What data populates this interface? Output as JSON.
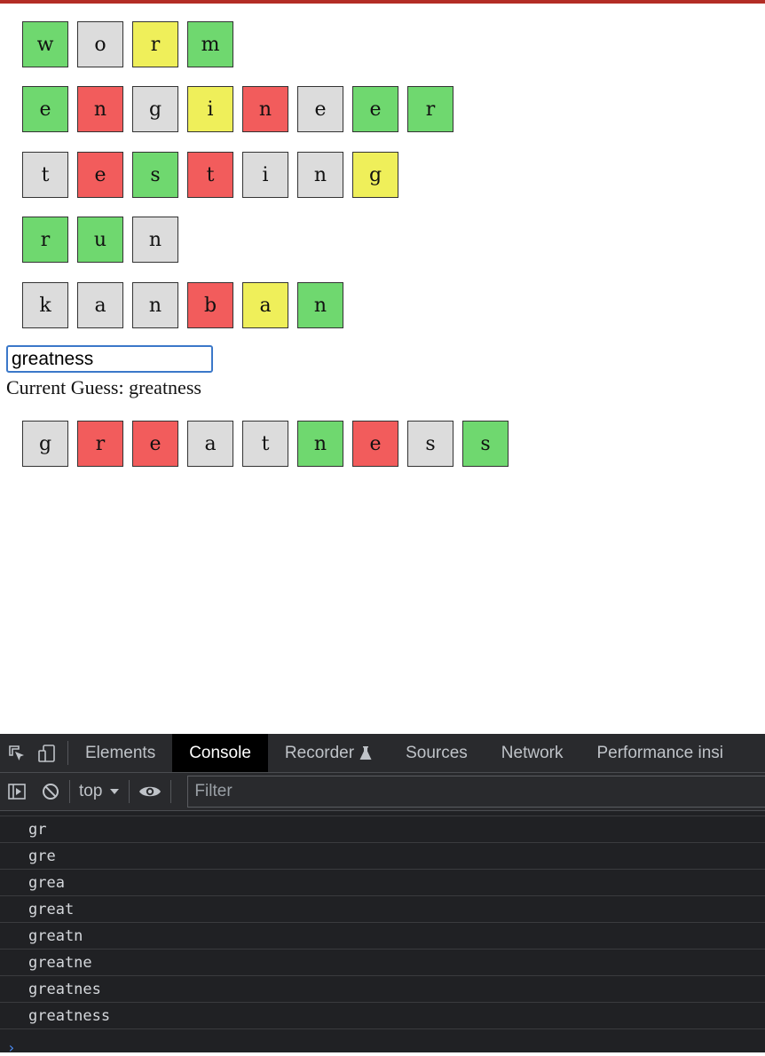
{
  "page": {
    "rows": [
      [
        {
          "letter": "w",
          "status": "green"
        },
        {
          "letter": "o",
          "status": "gray"
        },
        {
          "letter": "r",
          "status": "yellow"
        },
        {
          "letter": "m",
          "status": "green"
        }
      ],
      [
        {
          "letter": "e",
          "status": "green"
        },
        {
          "letter": "n",
          "status": "red"
        },
        {
          "letter": "g",
          "status": "gray"
        },
        {
          "letter": "i",
          "status": "yellow"
        },
        {
          "letter": "n",
          "status": "red"
        },
        {
          "letter": "e",
          "status": "gray"
        },
        {
          "letter": "e",
          "status": "green"
        },
        {
          "letter": "r",
          "status": "green"
        }
      ],
      [
        {
          "letter": "t",
          "status": "gray"
        },
        {
          "letter": "e",
          "status": "red"
        },
        {
          "letter": "s",
          "status": "green"
        },
        {
          "letter": "t",
          "status": "red"
        },
        {
          "letter": "i",
          "status": "gray"
        },
        {
          "letter": "n",
          "status": "gray"
        },
        {
          "letter": "g",
          "status": "yellow"
        }
      ],
      [
        {
          "letter": "r",
          "status": "green"
        },
        {
          "letter": "u",
          "status": "green"
        },
        {
          "letter": "n",
          "status": "gray"
        }
      ],
      [
        {
          "letter": "k",
          "status": "gray"
        },
        {
          "letter": "a",
          "status": "gray"
        },
        {
          "letter": "n",
          "status": "gray"
        },
        {
          "letter": "b",
          "status": "red"
        },
        {
          "letter": "a",
          "status": "yellow"
        },
        {
          "letter": "n",
          "status": "green"
        }
      ]
    ],
    "input_value": "greatness",
    "current_guess_text": "Current Guess: greatness",
    "current_guess_row": [
      {
        "letter": "g",
        "status": "gray"
      },
      {
        "letter": "r",
        "status": "red"
      },
      {
        "letter": "e",
        "status": "red"
      },
      {
        "letter": "a",
        "status": "gray"
      },
      {
        "letter": "t",
        "status": "gray"
      },
      {
        "letter": "n",
        "status": "green"
      },
      {
        "letter": "e",
        "status": "red"
      },
      {
        "letter": "s",
        "status": "gray"
      },
      {
        "letter": "s",
        "status": "green"
      }
    ],
    "colors": {
      "green": "#6fd86f",
      "red": "#f25c5c",
      "yellow": "#efef5a",
      "gray": "#dcdcdc"
    }
  },
  "devtools": {
    "tabs": [
      "Elements",
      "Console",
      "Recorder",
      "Sources",
      "Network",
      "Performance insi"
    ],
    "active_tab": "Console",
    "context": "top",
    "filter_placeholder": "Filter",
    "console_lines": [
      "gr",
      "gre",
      "grea",
      "great",
      "greatn",
      "greatne",
      "greatnes",
      "greatness"
    ],
    "icons": [
      "inspect-icon",
      "device-toggle-icon",
      "sidebar-toggle-icon",
      "clear-console-icon",
      "eye-icon",
      "flask-icon"
    ]
  }
}
